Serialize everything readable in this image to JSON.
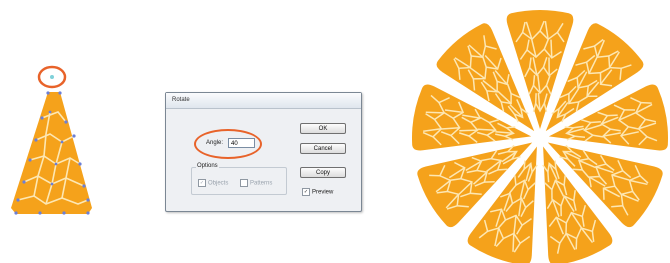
{
  "dialog": {
    "title": "Rotate",
    "angle_label": "Angle:",
    "angle_value": "40",
    "buttons": {
      "ok": "OK",
      "cancel": "Cancel",
      "copy": "Copy"
    },
    "options": {
      "legend": "Options",
      "objects_label": "Objects",
      "patterns_label": "Patterns"
    },
    "preview_label": "Preview",
    "preview_checked": true
  },
  "colors": {
    "orange": "#f5a21b",
    "highlight": "#e8632a",
    "cell_lines": "#fde7b3",
    "anchor_points": "#6b7fd7"
  }
}
